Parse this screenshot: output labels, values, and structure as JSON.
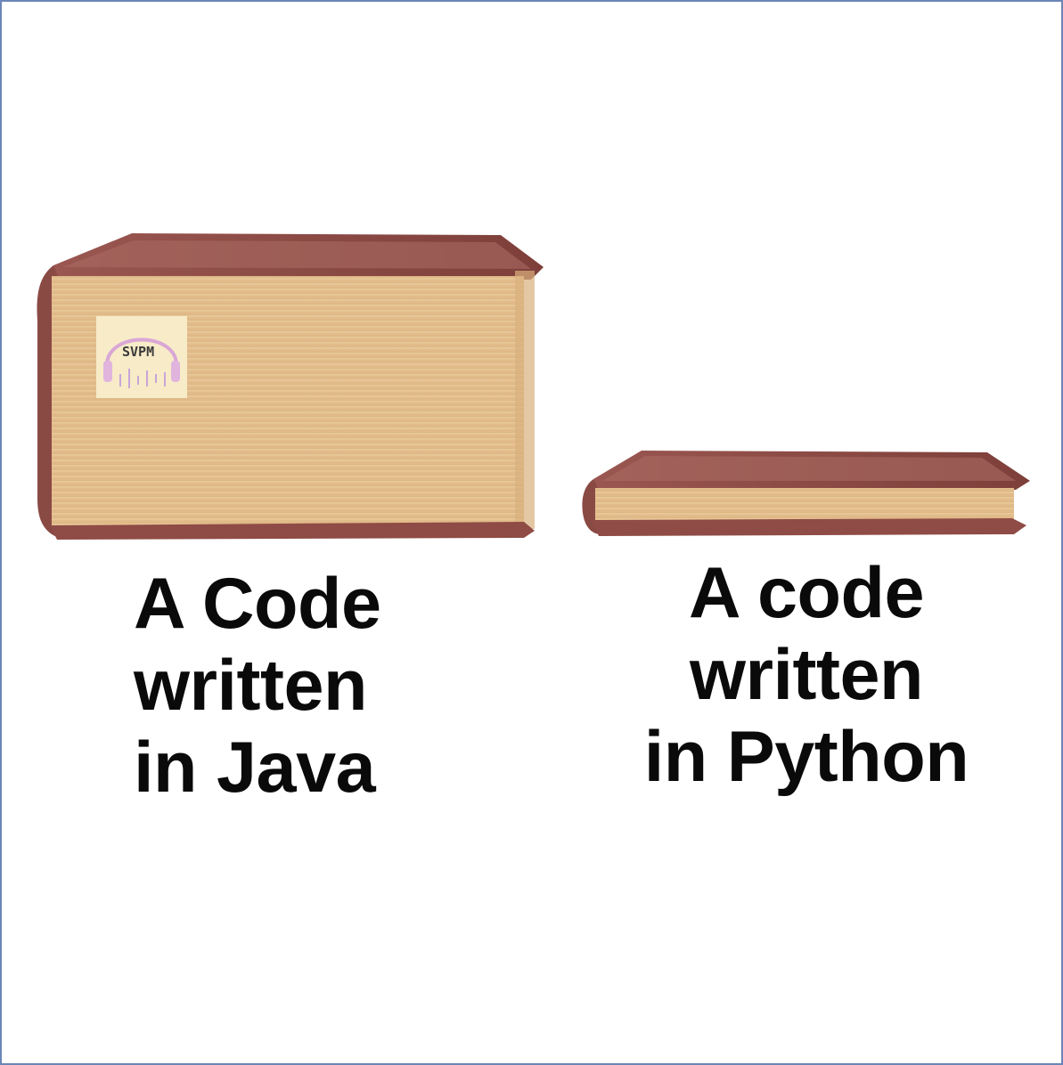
{
  "meme": {
    "left_caption": [
      "A Code",
      "written",
      "in Java"
    ],
    "right_caption": [
      "A code",
      "written",
      "in Python"
    ],
    "sticker_text": "SVPM"
  },
  "colors": {
    "cover": "#8f4a44",
    "cover_top": "#a5645d",
    "pages": "#e6c393",
    "frame": "#6b86b8"
  }
}
